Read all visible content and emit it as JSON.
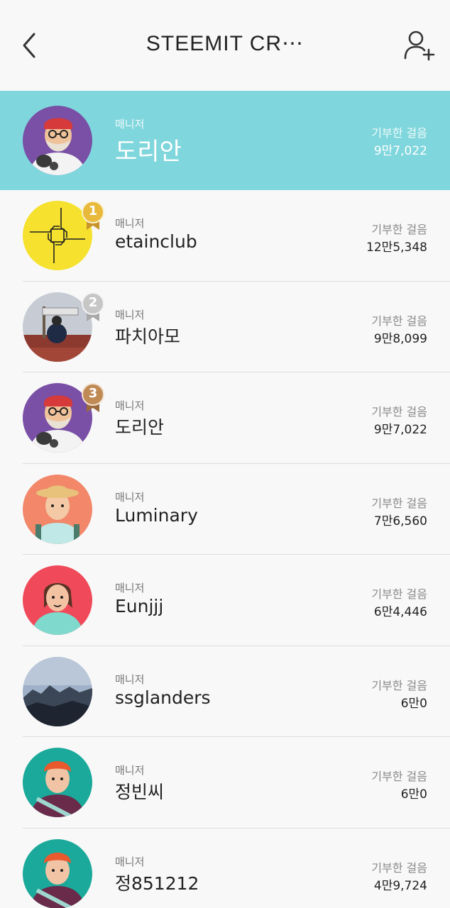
{
  "header": {
    "title": "STEEMIT CR⋯",
    "back_icon": "chevron-left-icon",
    "add_icon": "add-person-icon"
  },
  "colors": {
    "highlight": "#7fd6dc",
    "gold": "#e8b93a",
    "silver": "#c6c6c6",
    "bronze": "#c08a55"
  },
  "me": {
    "role": "매니저",
    "name": "도리안",
    "steps_label": "기부한 걸음",
    "steps": "9만7,022"
  },
  "members": [
    {
      "rank": "1",
      "role": "매니저",
      "name": "etainclub",
      "steps_label": "기부한 걸음",
      "steps": "12만5,348"
    },
    {
      "rank": "2",
      "role": "매니저",
      "name": "파치아모",
      "steps_label": "기부한 걸음",
      "steps": "9만8,099"
    },
    {
      "rank": "3",
      "role": "매니저",
      "name": "도리안",
      "steps_label": "기부한 걸음",
      "steps": "9만7,022"
    },
    {
      "rank": "",
      "role": "매니저",
      "name": "Luminary",
      "steps_label": "기부한 걸음",
      "steps": "7만6,560"
    },
    {
      "rank": "",
      "role": "매니저",
      "name": "Eunjjj",
      "steps_label": "기부한 걸음",
      "steps": "6만4,446"
    },
    {
      "rank": "",
      "role": "매니저",
      "name": "ssglanders",
      "steps_label": "기부한 걸음",
      "steps": "6만0"
    },
    {
      "rank": "",
      "role": "매니저",
      "name": "정빈씨",
      "steps_label": "기부한 걸음",
      "steps": "6만0"
    },
    {
      "rank": "",
      "role": "매니저",
      "name": "정851212",
      "steps_label": "기부한 걸음",
      "steps": "4만9,724"
    }
  ]
}
